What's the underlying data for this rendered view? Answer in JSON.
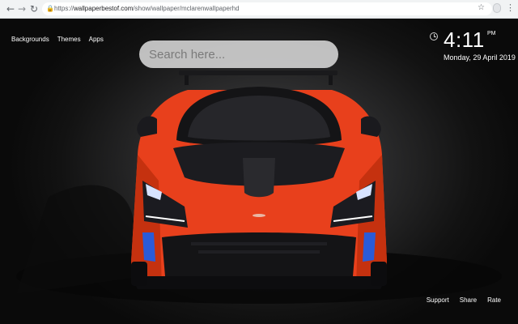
{
  "browser": {
    "url_prefix": "https://",
    "url_host": "wallpaperbestof.com",
    "url_path": "/show/wallpaper/mclarenwallpaperhd",
    "back_icon": "←",
    "forward_icon": "→",
    "reload_icon": "↻",
    "lock_icon": "🔒",
    "star_icon": "☆",
    "menu_icon": "⋮"
  },
  "nav": {
    "items": [
      {
        "label": "Backgrounds"
      },
      {
        "label": "Themes"
      },
      {
        "label": "Apps"
      }
    ]
  },
  "search": {
    "placeholder": "Search here..."
  },
  "clock": {
    "time": "4:11",
    "ampm": "PM",
    "date": "Monday, 29 April 2019"
  },
  "footer": {
    "links": [
      {
        "label": "Support"
      },
      {
        "label": "Share"
      },
      {
        "label": "Rate"
      }
    ]
  },
  "colors": {
    "car_body": "#e8401c",
    "car_dark": "#1e1e22",
    "headlight_accent": "#2a5bd8",
    "background": "#111111"
  }
}
